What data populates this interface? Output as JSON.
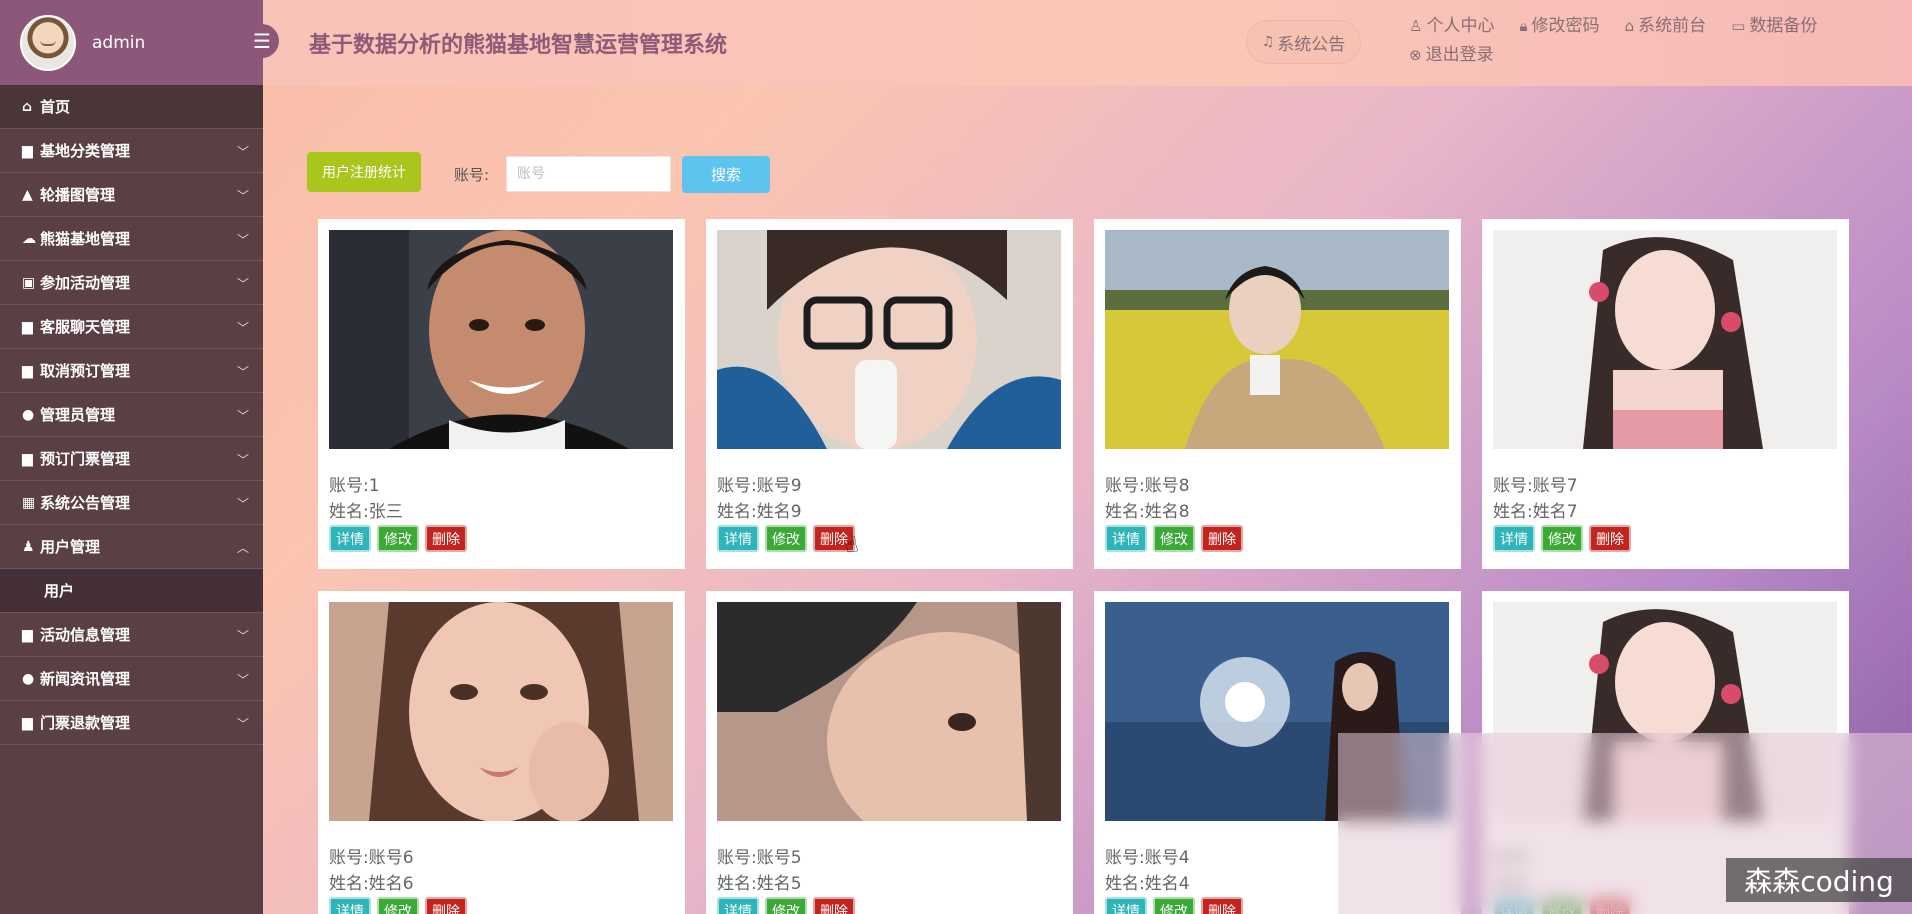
{
  "user": {
    "name": "admin"
  },
  "header": {
    "title": "基于数据分析的熊猫基地智慧运营管理系统",
    "notice_btn": "系统公告",
    "links": [
      "个人中心",
      "修改密码",
      "系统前台",
      "数据备份",
      "退出登录"
    ]
  },
  "sidebar": {
    "home": "首页",
    "items": [
      "基地分类管理",
      "轮播图管理",
      "熊猫基地管理",
      "参加活动管理",
      "客服聊天管理",
      "取消预订管理",
      "管理员管理",
      "预订门票管理",
      "系统公告管理",
      "用户管理",
      "活动信息管理",
      "新闻资讯管理",
      "门票退款管理"
    ],
    "expanded_sub": "用户"
  },
  "toolbar": {
    "stats_btn": "用户注册统计",
    "search_label": "账号:",
    "search_placeholder": "账号",
    "search_btn": "搜索"
  },
  "card_labels": {
    "account": "账号:",
    "name": "姓名:"
  },
  "actions": {
    "detail": "详情",
    "edit": "修改",
    "delete": "删除"
  },
  "cards": [
    {
      "account": "1",
      "name": "张三"
    },
    {
      "account": "账号9",
      "name": "姓名9"
    },
    {
      "account": "账号8",
      "name": "姓名8"
    },
    {
      "account": "账号7",
      "name": "姓名7"
    },
    {
      "account": "账号6",
      "name": "姓名6"
    },
    {
      "account": "账号5",
      "name": "姓名5"
    },
    {
      "account": "账号4",
      "name": "姓名4"
    },
    {
      "account": "",
      "name": ""
    }
  ],
  "watermark": "森森coding"
}
